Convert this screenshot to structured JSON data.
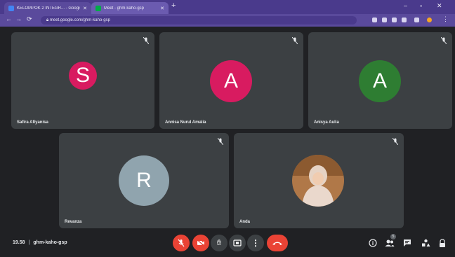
{
  "browser": {
    "tabs": [
      {
        "title": "KELOMPOK 2 INTEGR... - Google",
        "favicon_color": "#4285f4"
      },
      {
        "title": "Meet - ghm-kaho-gsp",
        "favicon_color": "#00ac47"
      }
    ],
    "url": "meet.google.com/ghm-kaho-gsp"
  },
  "participants": [
    {
      "name": "Safira Afiyanisa",
      "initial": "S",
      "color": "#d81b60"
    },
    {
      "name": "Annisa Nurul Amalia",
      "initial": "A",
      "color": "#d81b60"
    },
    {
      "name": "Anisya Aulia",
      "initial": "A",
      "color": "#2e7d32"
    },
    {
      "name": "Revanza",
      "initial": "R",
      "color": "#90a4ae"
    },
    {
      "name": "Anda",
      "initial": "",
      "color": ""
    }
  ],
  "meeting": {
    "time": "19.58",
    "code": "ghm-kaho-gsp",
    "participant_count": "5"
  },
  "colors": {
    "background": "#202124",
    "tile": "#3c4043",
    "danger": "#ea4335"
  }
}
